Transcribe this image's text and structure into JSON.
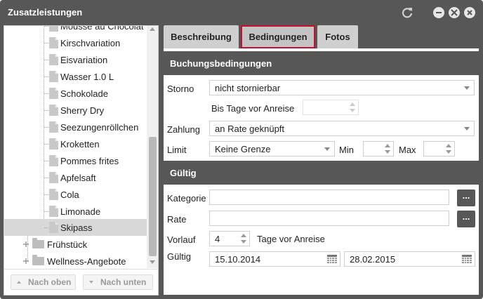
{
  "window": {
    "title": "Zusatzleistungen"
  },
  "tree": {
    "partial_top_item": "Mousse au Chocolat",
    "leaf_items": [
      "Kirschvariation",
      "Eisvariation",
      "Wasser 1.0 L",
      "Schokolade",
      "Sherry Dry",
      "Seezungenröllchen",
      "Kroketten",
      "Pommes frites",
      "Apfelsaft",
      "Cola",
      "Limonade",
      "Skipass"
    ],
    "selected": "Skipass",
    "folders": [
      "Frühstück",
      "Wellness-Angebote"
    ]
  },
  "left_footer": {
    "up_label": "Nach oben",
    "down_label": "Nach unten"
  },
  "tabs": [
    {
      "label": "Beschreibung"
    },
    {
      "label": "Bedingungen",
      "active": true
    },
    {
      "label": "Fotos"
    }
  ],
  "booking": {
    "section_title": "Buchungsbedingungen",
    "storno_label": "Storno",
    "storno_value": "nicht stornierbar",
    "days_before_label": "Bis Tage vor Anreise",
    "days_before_value": "",
    "payment_label": "Zahlung",
    "payment_value": "an Rate geknüpft",
    "limit_label": "Limit",
    "limit_value": "Keine Grenze",
    "min_label": "Min",
    "min_value": "",
    "max_label": "Max",
    "max_value": ""
  },
  "valid": {
    "section_title": "Gültig",
    "category_label": "Kategorie",
    "category_value": "",
    "rate_label": "Rate",
    "rate_value": "",
    "lead_label": "Vorlauf",
    "lead_value": "4",
    "lead_suffix": "Tage vor Anreise",
    "valid_label": "Gültig",
    "from_date": "15.10.2014",
    "to_date": "28.02.2015",
    "browse_label": "..."
  },
  "colors": {
    "header": "#575757",
    "active_tab_border": "#c8102e",
    "selection": "#d8d8d8"
  },
  "icons": [
    "refresh-icon",
    "minimize-icon",
    "maximize-icon",
    "close-icon",
    "document-icon",
    "folder-icon",
    "calendar-icon"
  ]
}
